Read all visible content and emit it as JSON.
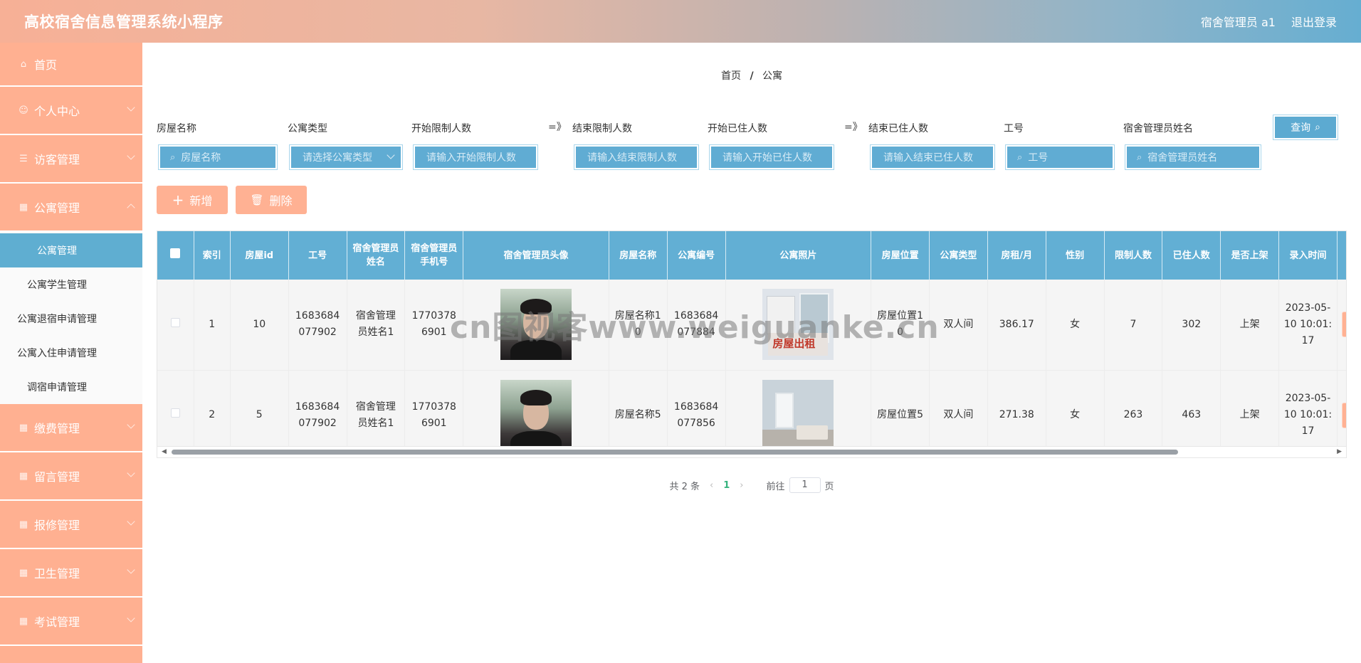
{
  "header": {
    "title": "高校宿舍信息管理系统小程序",
    "user": "宿舍管理员 a1",
    "logout": "退出登录"
  },
  "sidebar": {
    "items": [
      {
        "label": "首页",
        "icon": "home-icon"
      },
      {
        "label": "个人中心",
        "icon": "user-icon"
      },
      {
        "label": "访客管理",
        "icon": "list-icon"
      },
      {
        "label": "公寓管理",
        "icon": "apartment-icon"
      }
    ],
    "subitems": [
      {
        "label": "公寓管理",
        "active": true
      },
      {
        "label": "公寓学生管理"
      },
      {
        "label": "公寓退宿申请管理"
      },
      {
        "label": "公寓入住申请管理"
      },
      {
        "label": "调宿申请管理"
      }
    ],
    "items_bottom": [
      {
        "label": "缴费管理"
      },
      {
        "label": "留言管理"
      },
      {
        "label": "报修管理"
      },
      {
        "label": "卫生管理"
      },
      {
        "label": "考试管理"
      }
    ]
  },
  "breadcrumb": {
    "home": "首页",
    "sep": "/",
    "current": "公寓"
  },
  "filters": {
    "name_label": "房屋名称",
    "name_placeholder": "房屋名称",
    "type_label": "公寓类型",
    "type_placeholder": "请选择公寓类型",
    "start_limit_label": "开始限制人数",
    "start_limit_placeholder": "请输入开始限制人数",
    "arrow": "=》",
    "end_limit_label": "结束限制人数",
    "end_limit_placeholder": "请输入结束限制人数",
    "start_live_label": "开始已住人数",
    "start_live_placeholder": "请输入开始已住人数",
    "end_live_label": "结束已住人数",
    "end_live_placeholder": "请输入结束已住人数",
    "id_label": "工号",
    "id_placeholder": "工号",
    "manager_label": "宿舍管理员姓名",
    "manager_placeholder": "宿舍管理员姓名",
    "query": "查询"
  },
  "actions": {
    "add": "新增",
    "delete": "删除"
  },
  "table": {
    "headers": [
      "索引",
      "房屋id",
      "工号",
      "宿舍管理员姓名",
      "宿舍管理员手机号",
      "宿舍管理员头像",
      "房屋名称",
      "公寓编号",
      "公寓照片",
      "房屋位置",
      "公寓类型",
      "房租/月",
      "性别",
      "限制人数",
      "已住人数",
      "是否上架",
      "录入时间"
    ],
    "rows": [
      {
        "index": "1",
        "house_id": "10",
        "job_no": "1683684077902",
        "manager": "宿舍管理员姓名1",
        "phone": "17703786901",
        "house_name": "房屋名称10",
        "apt_no": "1683684077884",
        "location": "房屋位置10",
        "type": "双人间",
        "rent": "386.17",
        "gender": "女",
        "limit": "7",
        "living": "302",
        "on_shelf": "上架",
        "time": "2023-05-10 10:01:17"
      },
      {
        "index": "2",
        "house_id": "5",
        "job_no": "1683684077902",
        "manager": "宿舍管理员姓名1",
        "phone": "17703786901",
        "house_name": "房屋名称5",
        "apt_no": "1683684077856",
        "location": "房屋位置5",
        "type": "双人间",
        "rent": "271.38",
        "gender": "女",
        "limit": "263",
        "living": "463",
        "on_shelf": "上架",
        "time": "2023-05-10 10:01:17"
      }
    ],
    "poster_text": "房屋出租"
  },
  "pagination": {
    "total": "共 2 条",
    "current": "1",
    "goto": "前往",
    "page_input": "1",
    "page_unit": "页"
  },
  "watermark": "cn图视客www.weiguanke.cn",
  "colors": {
    "accent_orange": "#ffb091",
    "accent_blue": "#62afd4"
  }
}
